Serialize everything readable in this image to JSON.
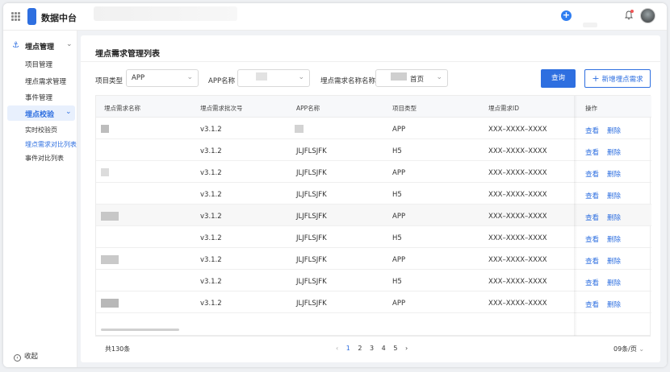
{
  "app": {
    "title": "数据中台",
    "icons": [
      "grid-icon",
      "plus-icon",
      "bell-icon",
      "avatar"
    ]
  },
  "sidebar": {
    "groups": [
      {
        "label": "埋点管理",
        "icon": "anchor-icon",
        "items": [
          "项目管理",
          "埋点需求管理",
          "事件管理"
        ]
      },
      {
        "label": "埋点校验",
        "items": [
          "实时校验页",
          "埋点需求对比列表",
          "事件对比列表"
        ],
        "active_item": "埋点需求对比列表"
      }
    ],
    "collapse_label": "收起"
  },
  "page": {
    "title": "埋点需求管理列表"
  },
  "filters": {
    "project_type_label": "项目类型",
    "project_type_value": "APP",
    "app_name_label": "APP名称",
    "req_name_label": "埋点需求名称名称",
    "req_name_value": "首页",
    "query_button": "查询",
    "add_button": "新增埋点需求"
  },
  "table": {
    "columns": [
      "埋点需求名称",
      "埋点需求批次号",
      "APP名称",
      "项目类型",
      "埋点需求ID",
      "操作"
    ],
    "rows": [
      {
        "batch": "v3.1.2",
        "app": "",
        "type": "APP",
        "id": "XXX–XXXX–XXXX"
      },
      {
        "batch": "v3.1.2",
        "app": "JLJFLSJFK",
        "type": "H5",
        "id": "XXX–XXXX–XXXX"
      },
      {
        "batch": "v3.1.2",
        "app": "JLJFLSJFK",
        "type": "APP",
        "id": "XXX–XXXX–XXXX"
      },
      {
        "batch": "v3.1.2",
        "app": "JLJFLSJFK",
        "type": "H5",
        "id": "XXX–XXXX–XXXX"
      },
      {
        "batch": "v3.1.2",
        "app": "JLJFLSJFK",
        "type": "APP",
        "id": "XXX–XXXX–XXXX"
      },
      {
        "batch": "v3.1.2",
        "app": "JLJFLSJFK",
        "type": "H5",
        "id": "XXX–XXXX–XXXX"
      },
      {
        "batch": "v3.1.2",
        "app": "JLJFLSJFK",
        "type": "APP",
        "id": "XXX–XXXX–XXXX"
      },
      {
        "batch": "v3.1.2",
        "app": "JLJFLSJFK",
        "type": "H5",
        "id": "XXX–XXXX–XXXX"
      },
      {
        "batch": "v3.1.2",
        "app": "JLJFLSJFK",
        "type": "APP",
        "id": "XXX–XXXX–XXXX"
      }
    ],
    "view_label": "查看",
    "delete_label": "删除"
  },
  "pagination": {
    "total": "共130条",
    "pages": [
      "1",
      "2",
      "3",
      "4",
      "5"
    ],
    "current": "1",
    "page_size": "09条/页"
  },
  "colors": {
    "accent": "#2e6fe0",
    "danger_dot": "#f05454"
  }
}
